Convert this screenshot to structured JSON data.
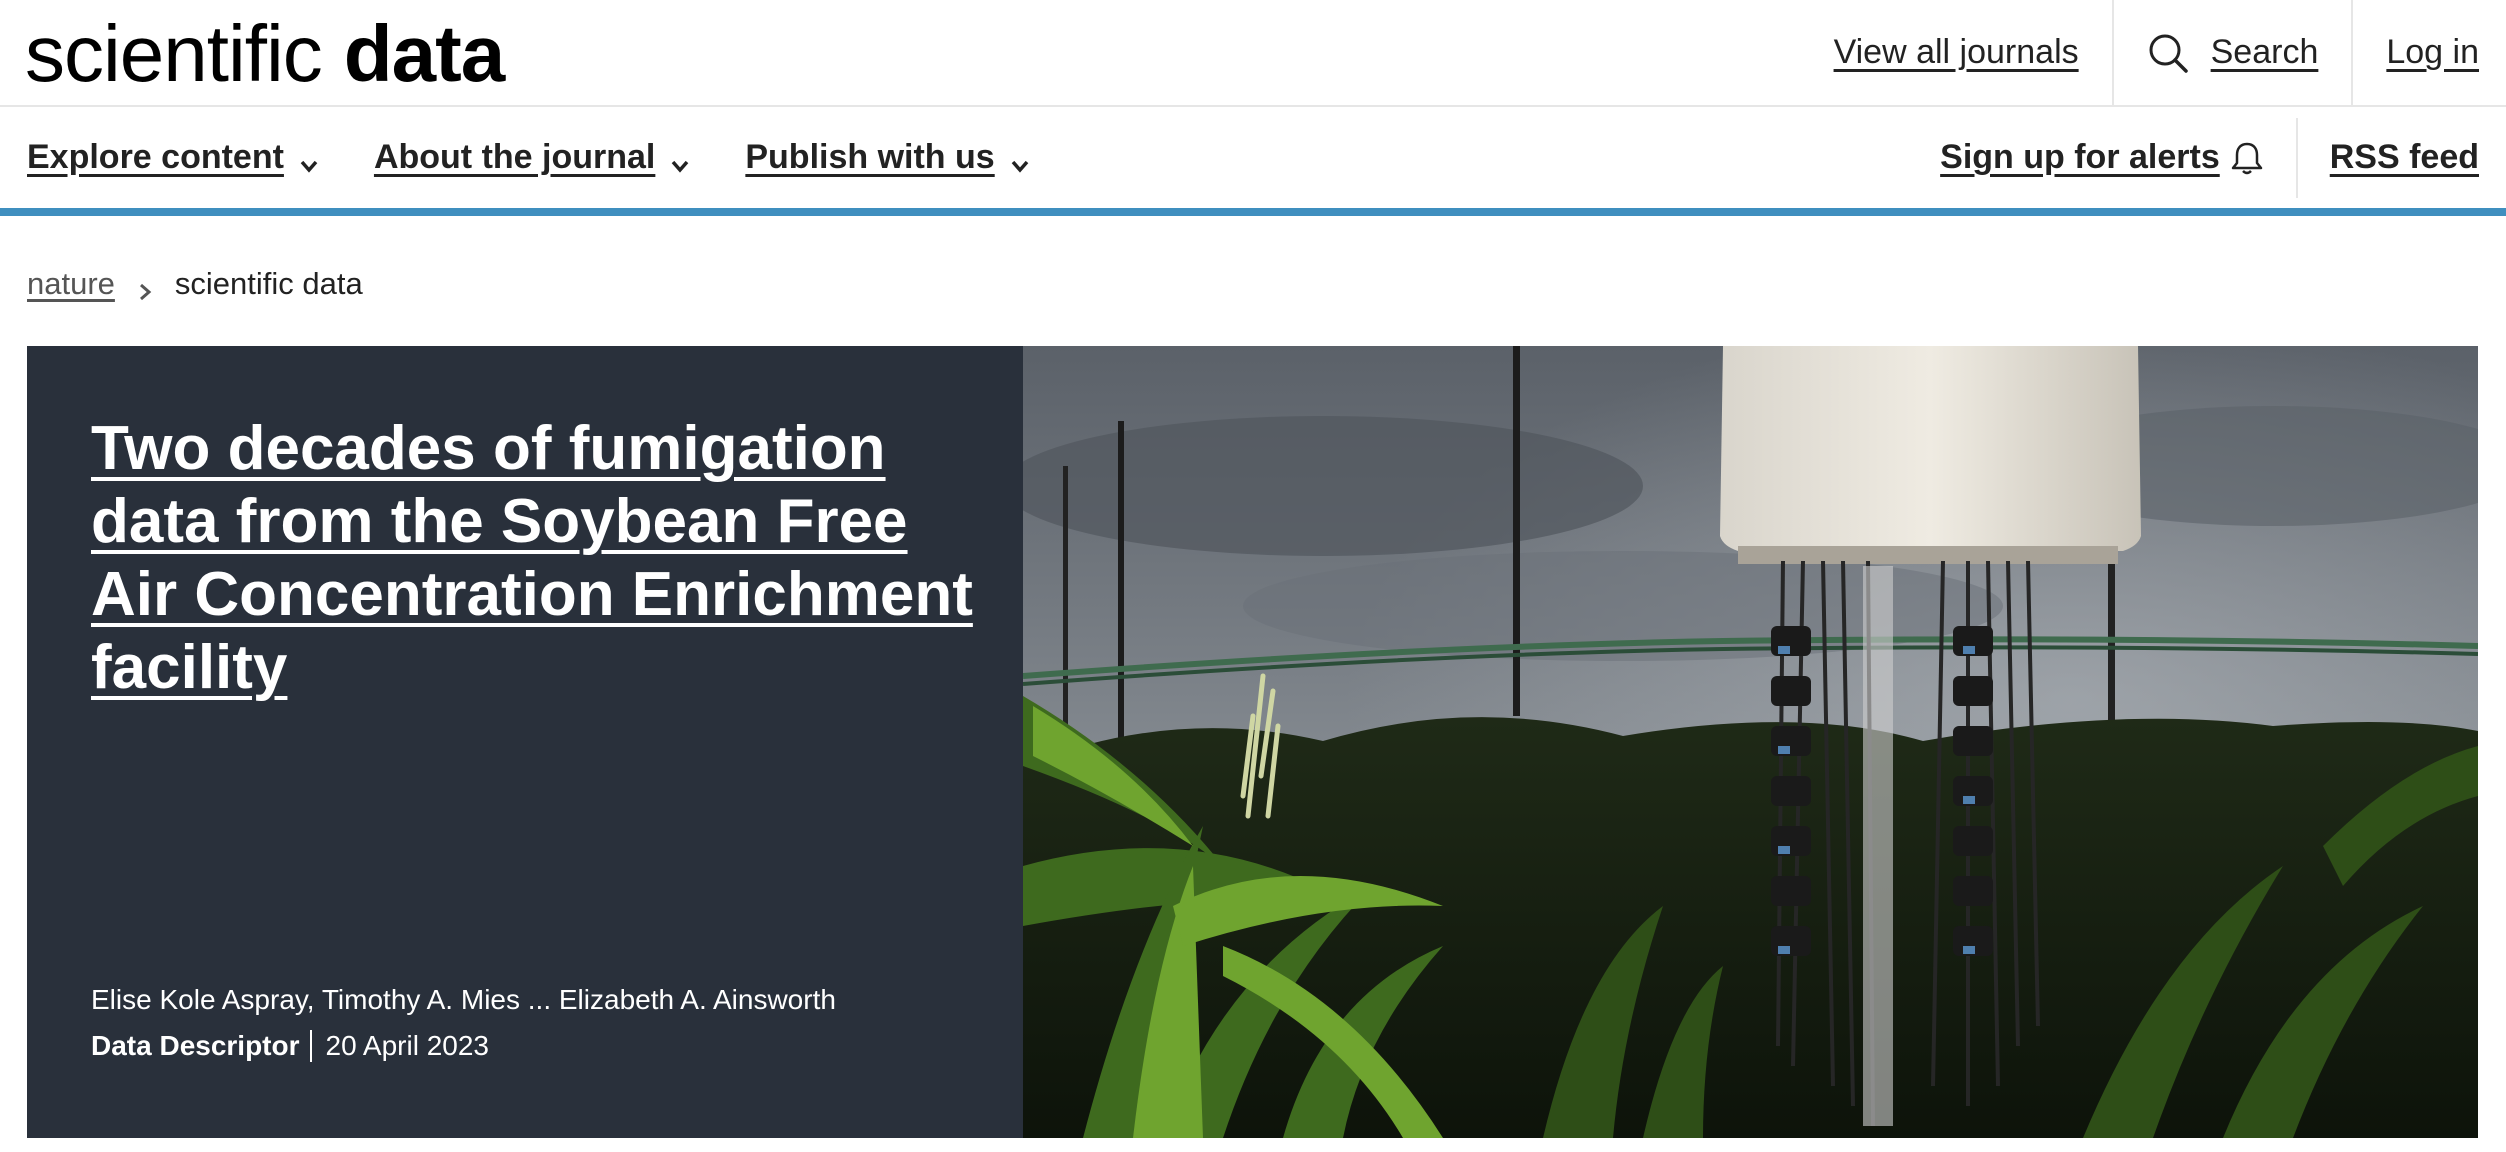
{
  "header": {
    "logo_light": "scientific",
    "logo_bold": "data",
    "view_all_journals": "View all journals",
    "search_label": "Search",
    "login_label": "Log in"
  },
  "nav": {
    "items": [
      {
        "label": "Explore content"
      },
      {
        "label": "About the journal"
      },
      {
        "label": "Publish with us"
      }
    ],
    "alerts_label": "Sign up for alerts",
    "rss_label": "RSS feed",
    "accent_color": "#3f8fbf"
  },
  "breadcrumb": {
    "root": "nature",
    "current": "scientific data"
  },
  "hero": {
    "title": "Two decades of fumigation data from the Soybean Free Air Concentration Enrichment facility",
    "authors": "Elise Kole Aspray, Timothy A. Mies ... Elizabeth A. Ainsworth",
    "article_type": "Data Descriptor",
    "date": "20 April 2023",
    "panel_color": "#29303b"
  },
  "icons": {
    "search": "search-icon",
    "chevron": "chevron-down-icon",
    "bell": "bell-icon",
    "breadcrumb_separator": "chevron-right-icon"
  }
}
